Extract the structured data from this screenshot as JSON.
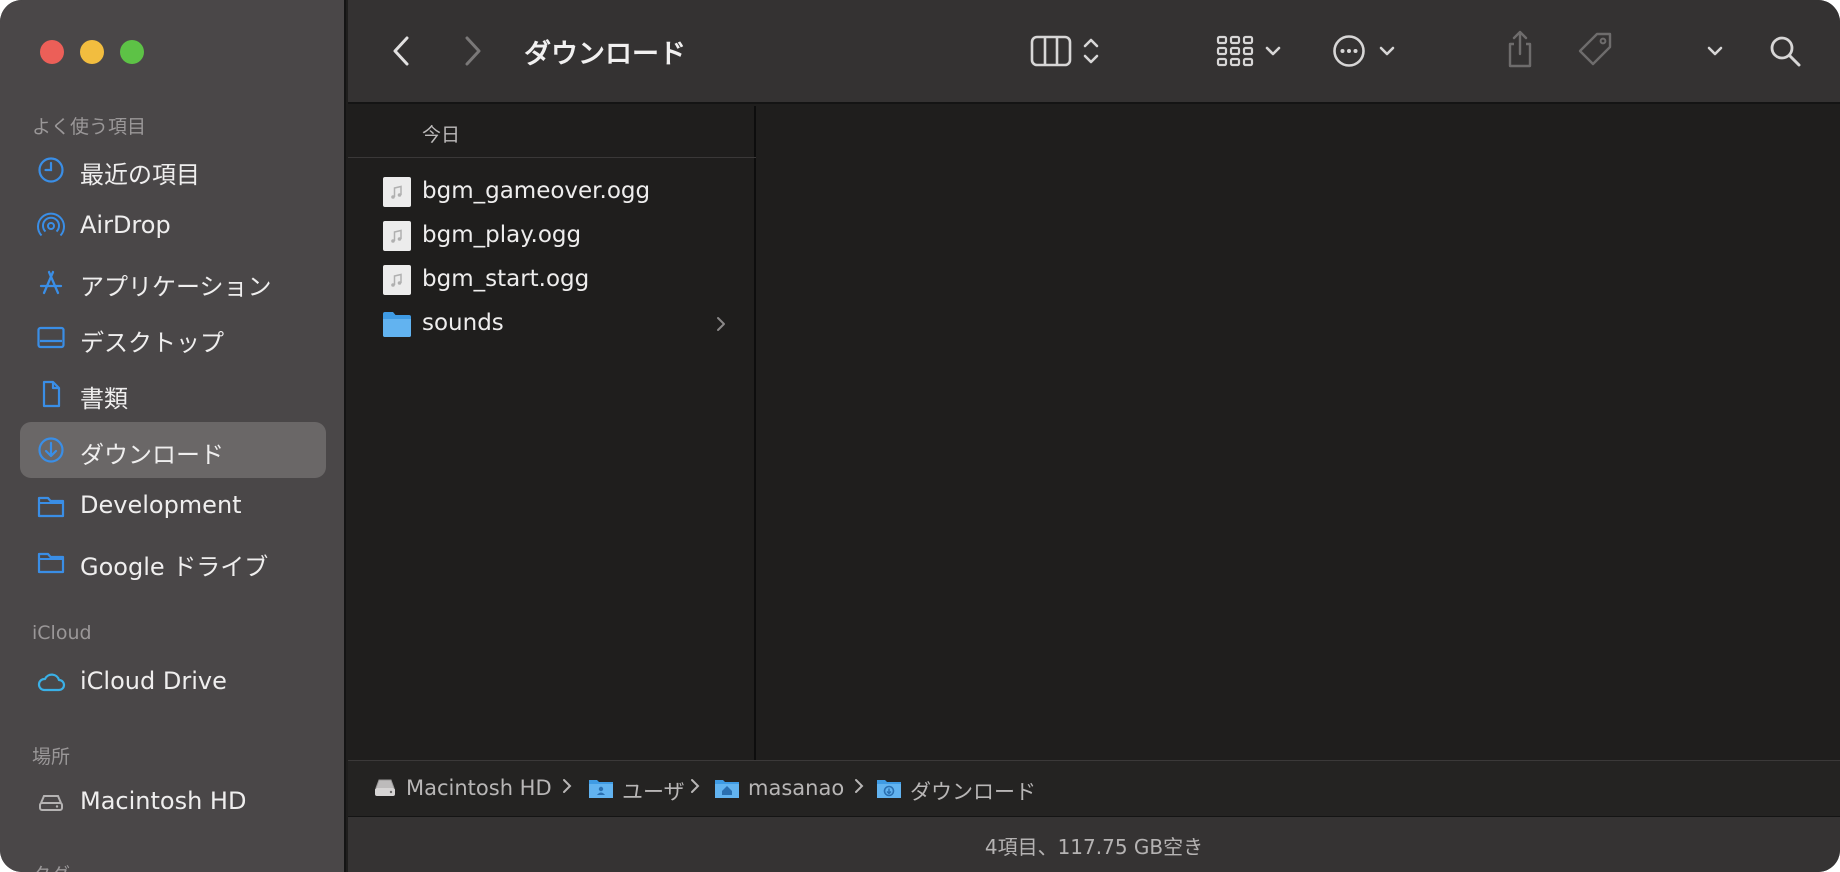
{
  "window": {
    "title": "ダウンロード"
  },
  "sidebar": {
    "favorites_label": "よく使う項目",
    "favorites": [
      {
        "label": "最近の項目",
        "icon": "clock-icon"
      },
      {
        "label": "AirDrop",
        "icon": "airdrop-icon"
      },
      {
        "label": "アプリケーション",
        "icon": "applications-icon"
      },
      {
        "label": "デスクトップ",
        "icon": "desktop-icon"
      },
      {
        "label": "書類",
        "icon": "document-icon"
      },
      {
        "label": "ダウンロード",
        "icon": "download-icon",
        "selected": true
      },
      {
        "label": "Development",
        "icon": "folder-icon"
      },
      {
        "label": "Google ドライブ",
        "icon": "folder-icon"
      }
    ],
    "icloud_label": "iCloud",
    "icloud": [
      {
        "label": "iCloud Drive",
        "icon": "cloud-icon"
      }
    ],
    "locations_label": "場所",
    "locations": [
      {
        "label": "Macintosh HD",
        "icon": "harddrive-icon"
      }
    ],
    "tags_label": "タグ"
  },
  "toolbar": {
    "icons": [
      "back-icon",
      "forward-icon",
      "column-view-icon",
      "group-icon",
      "more-actions-icon",
      "share-icon",
      "tag-icon",
      "expand-chevron-icon",
      "search-icon"
    ]
  },
  "column1": {
    "header": "今日",
    "items": [
      {
        "name": "bgm_gameover.ogg",
        "icon": "audio-file-icon"
      },
      {
        "name": "bgm_play.ogg",
        "icon": "audio-file-icon"
      },
      {
        "name": "bgm_start.ogg",
        "icon": "audio-file-icon"
      },
      {
        "name": "sounds",
        "icon": "folder-icon",
        "has_children": true
      }
    ]
  },
  "pathbar": {
    "crumbs": [
      {
        "label": "Macintosh HD",
        "icon": "harddrive-icon"
      },
      {
        "label": "ユーザ",
        "icon": "users-folder-icon"
      },
      {
        "label": "masanao",
        "icon": "home-folder-icon"
      },
      {
        "label": "ダウンロード",
        "icon": "download-folder-icon"
      }
    ]
  },
  "status": {
    "text": "4項目、117.75 GB空き"
  },
  "colors": {
    "accent": "#3a8ee6",
    "sidebar_bg": "#4a4748",
    "content_bg": "#1f1e1d",
    "toolbar_bg": "#343232"
  }
}
